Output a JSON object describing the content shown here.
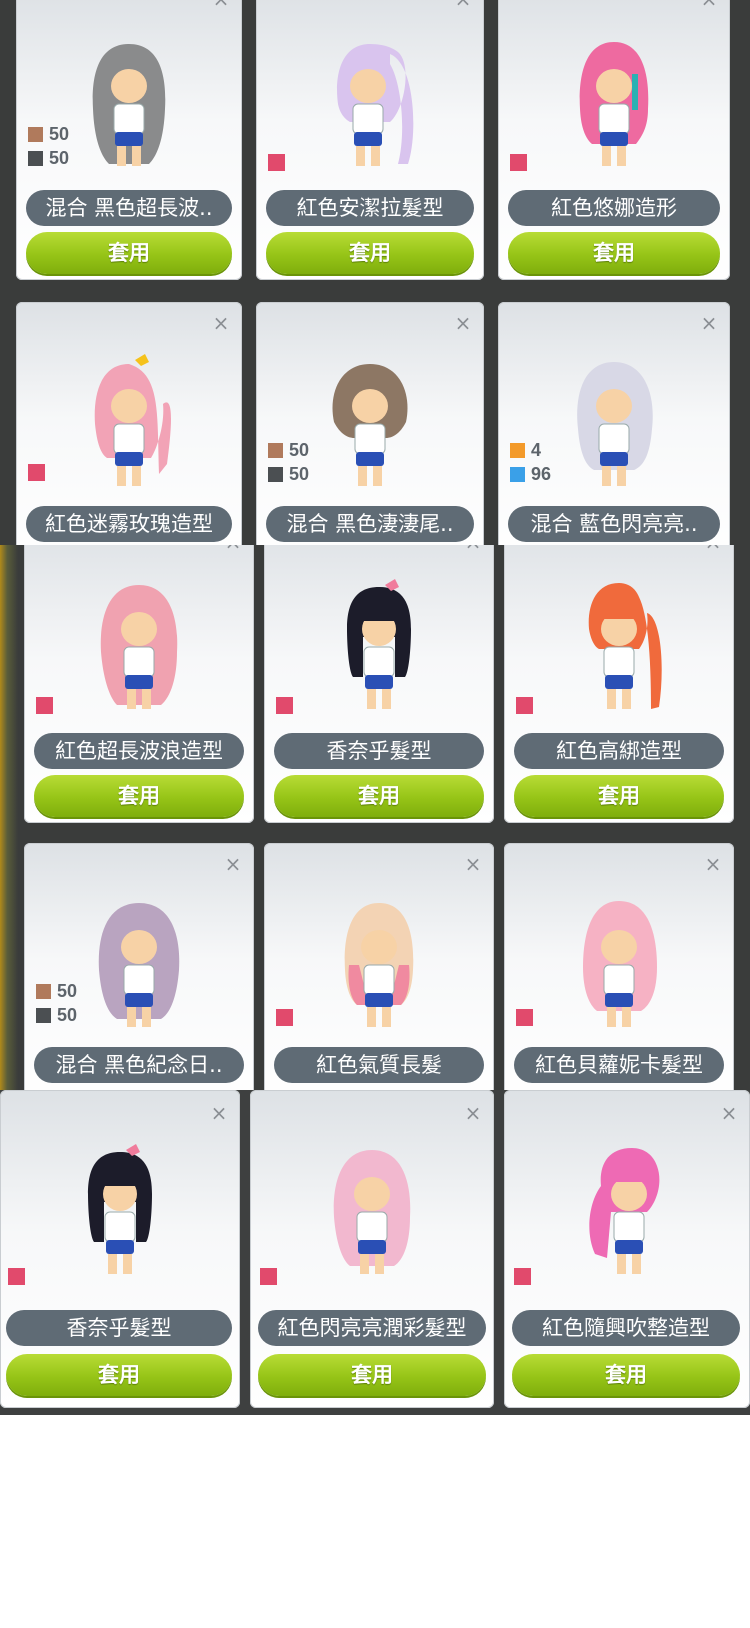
{
  "close_glyph": "×",
  "apply_label": "套用",
  "colors": {
    "brown": "#b07a5c",
    "dark_gray": "#4b4f52",
    "orange": "#f39a2a",
    "blue": "#3aa0e8",
    "pink_marker": "#e14a6c",
    "apply_green": "#96c417",
    "name_pill": "#5f6b75"
  },
  "strip1": {
    "row1": [
      {
        "name": "混合 黑色超長波..",
        "hair_color": "#8a8b8c",
        "swatches": [
          {
            "color": "#b07a5c",
            "value": "50"
          },
          {
            "color": "#4b4f52",
            "value": "50"
          }
        ]
      },
      {
        "name": "紅色安潔拉髮型",
        "hair_color": "#d9c4ee"
      },
      {
        "name": "紅色悠娜造形",
        "hair_color": "#ee6aa0"
      }
    ],
    "row2": [
      {
        "name": "紅色迷霧玫瑰造型",
        "hair_color": "#f2a3b6"
      },
      {
        "name": "混合 黑色淒淒尾..",
        "hair_color": "#8d7764",
        "swatches": [
          {
            "color": "#b07a5c",
            "value": "50"
          },
          {
            "color": "#4b4f52",
            "value": "50"
          }
        ]
      },
      {
        "name": "混合 藍色閃亮亮..",
        "hair_color": "#d8d8e6",
        "swatches": [
          {
            "color": "#f39a2a",
            "value": "4"
          },
          {
            "color": "#3aa0e8",
            "value": "96"
          }
        ]
      }
    ]
  },
  "strip2": {
    "row1": [
      {
        "name": "紅色超長波浪造型",
        "hair_color": "#f0a2b0"
      },
      {
        "name": "香奈乎髮型",
        "hair_color": "#1c1c2a"
      },
      {
        "name": "紅色高綁造型",
        "hair_color": "#f06a3c"
      }
    ],
    "row2": [
      {
        "name": "混合 黑色紀念日..",
        "hair_color": "#b9a4c0",
        "swatches": [
          {
            "color": "#b07a5c",
            "value": "50"
          },
          {
            "color": "#4b4f52",
            "value": "50"
          }
        ]
      },
      {
        "name": "紅色氣質長髮",
        "hair_color": "#f3d3b4"
      },
      {
        "name": "紅色貝蘿妮卡髮型",
        "hair_color": "#f6b2c4"
      }
    ]
  },
  "strip3": {
    "row1": [
      {
        "name": "香奈乎髮型",
        "hair_color": "#1c1c2a"
      },
      {
        "name": "紅色閃亮亮潤彩髮型",
        "hair_color": "#f2b8cf"
      },
      {
        "name": "紅色隨興吹整造型",
        "hair_color": "#ee6ab4"
      }
    ]
  }
}
